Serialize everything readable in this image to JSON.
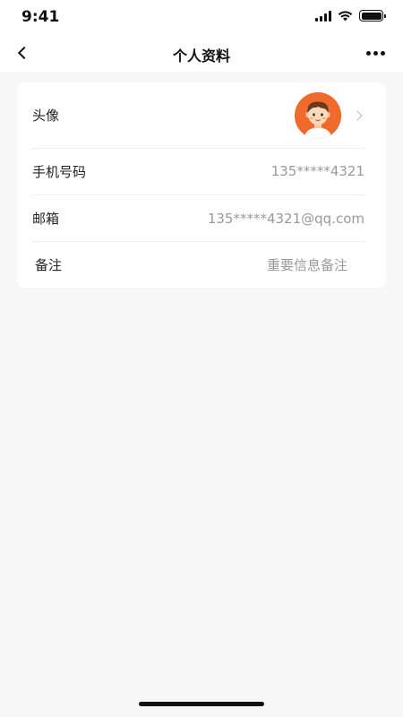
{
  "status_bar": {
    "time": "9:41"
  },
  "nav": {
    "title": "个人资料"
  },
  "profile": {
    "avatar_label": "头像",
    "phone_label": "手机号码",
    "phone_value": "135*****4321",
    "email_label": "邮箱",
    "email_value": "135*****4321@qq.com",
    "note_label": "备注",
    "note_placeholder": "重要信息备注"
  },
  "icons": {
    "back": "chevron-left-icon",
    "more": "more-horizontal-icon",
    "avatar": "cartoon-boy-avatar",
    "row_arrow": "chevron-right-icon",
    "signal": "cellular-signal-icon",
    "wifi": "wifi-icon",
    "battery": "battery-icon"
  },
  "colors": {
    "background": "#f7f7f7",
    "card": "#ffffff",
    "avatar_bg": "#f06b2b",
    "value_text": "#9a9a9a",
    "divider": "#eeeeee"
  }
}
